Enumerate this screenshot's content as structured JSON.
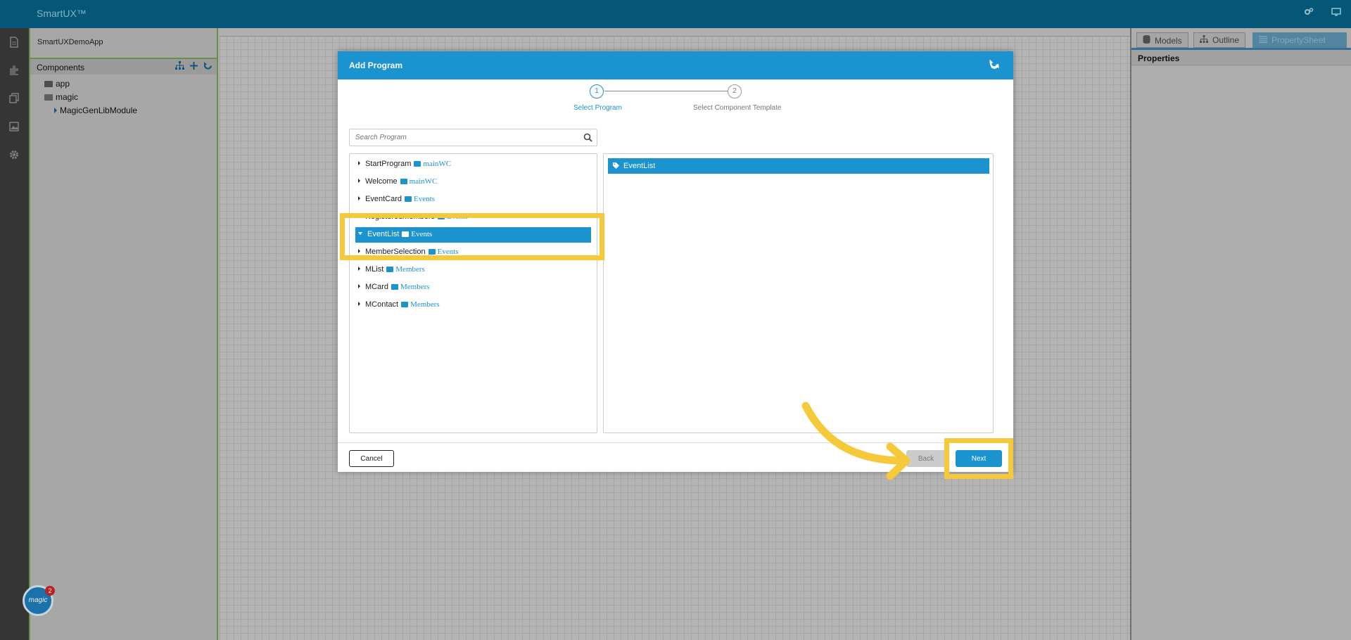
{
  "app": {
    "brand": "SmartUX™"
  },
  "left_panel": {
    "app_name": "SmartUXDemoApp",
    "components_title": "Components",
    "tree": [
      {
        "label": "app",
        "type": "folder"
      },
      {
        "label": "magic",
        "type": "folder-open"
      },
      {
        "label": "MagicGenLibModule",
        "type": "module"
      }
    ]
  },
  "right_panel": {
    "tabs": [
      {
        "label": "Models",
        "icon": "database-icon"
      },
      {
        "label": "Outline",
        "icon": "sitemap-icon"
      },
      {
        "label": "PropertySheet",
        "icon": "list-icon",
        "active": true
      }
    ],
    "properties_title": "Properties"
  },
  "logo": {
    "text": "magic",
    "badge": "2"
  },
  "dialog": {
    "title": "Add Program",
    "steps": [
      {
        "number": "1",
        "label": "Select Program",
        "active": true
      },
      {
        "number": "2",
        "label": "Select Component Template",
        "active": false
      }
    ],
    "search": {
      "placeholder": "Search Program",
      "value": ""
    },
    "programs": [
      {
        "name": "StartProgram",
        "folder": "mainWC"
      },
      {
        "name": "Welcome",
        "folder": "mainWC"
      },
      {
        "name": "EventCard",
        "folder": "Events"
      },
      {
        "name": "RegisteredMembers",
        "folder": "Events"
      },
      {
        "name": "EventList",
        "folder": "Events",
        "selected": true
      },
      {
        "name": "MemberSelection",
        "folder": "Events"
      },
      {
        "name": "MList",
        "folder": "Members"
      },
      {
        "name": "MCard",
        "folder": "Members"
      },
      {
        "name": "MContact",
        "folder": "Members"
      }
    ],
    "selected_detail": "EventList",
    "buttons": {
      "cancel": "Cancel",
      "back": "Back",
      "next": "Next"
    }
  },
  "colors": {
    "accent": "#1a93cf",
    "topbar": "#075e83",
    "highlight": "#f6c93a"
  }
}
